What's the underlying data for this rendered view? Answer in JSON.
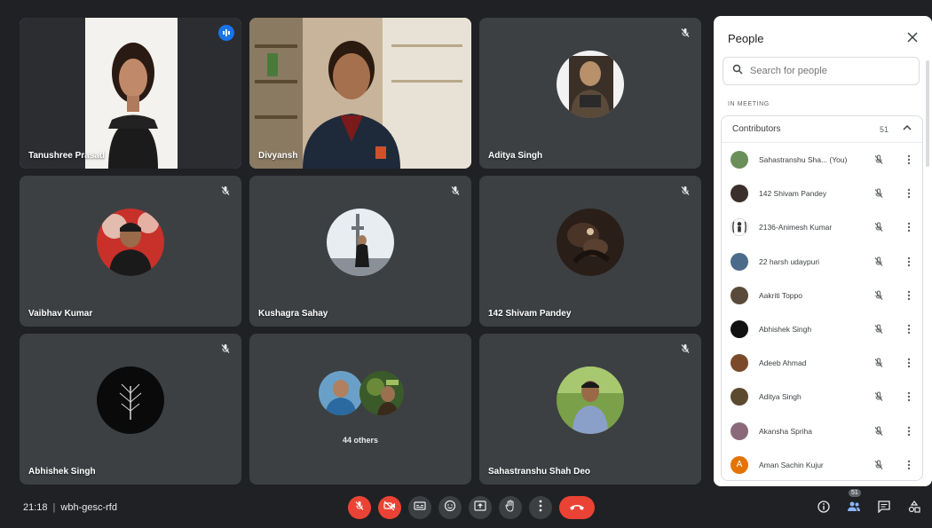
{
  "tiles": [
    {
      "name": "Tanushree Prasad",
      "kind": "video",
      "speaking": true
    },
    {
      "name": "Divyansh",
      "kind": "video"
    },
    {
      "name": "Aditya Singh",
      "kind": "avatar",
      "muted": true
    },
    {
      "name": "Vaibhav Kumar",
      "kind": "avatar",
      "muted": true
    },
    {
      "name": "Kushagra Sahay",
      "kind": "avatar",
      "muted": true
    },
    {
      "name": "142 Shivam Pandey",
      "kind": "avatar",
      "muted": true
    },
    {
      "name": "Abhishek Singh",
      "kind": "avatar",
      "muted": true
    },
    {
      "name": "",
      "kind": "others",
      "others_label": "44 others"
    },
    {
      "name": "Sahastranshu Shah Deo",
      "kind": "avatar",
      "muted": true
    }
  ],
  "panel": {
    "title": "People",
    "search_placeholder": "Search for people",
    "in_meeting_label": "IN MEETING",
    "contributors_label": "Contributors",
    "contributors_count": "51",
    "people": [
      {
        "name": "Sahastranshu Sha...  (You)",
        "color": "#6b8f5a"
      },
      {
        "name": "142 Shivam Pandey",
        "color": "#3a2f2a"
      },
      {
        "name": "2136-Animesh Kumar",
        "color": "#ffffff"
      },
      {
        "name": "22 harsh udaypuri",
        "color": "#4a6b8a"
      },
      {
        "name": "Aakriti Toppo",
        "color": "#5a4a3a"
      },
      {
        "name": "Abhishek Singh",
        "color": "#111111"
      },
      {
        "name": "Adeeb Ahmad",
        "color": "#7a4a2a"
      },
      {
        "name": "Aditya Singh",
        "color": "#5c4a2e"
      },
      {
        "name": "Akansha Spriha",
        "color": "#8a6a7a"
      },
      {
        "name": "Aman Sachin Kujur",
        "color": "#e37400",
        "initial": "A"
      }
    ]
  },
  "bottom": {
    "time": "21:18",
    "meeting_code": "wbh-gesc-rfd",
    "people_badge": "51"
  },
  "icons": {
    "mic_off": "mic-off-icon",
    "cam_off": "camera-off-icon",
    "cc": "captions-icon",
    "emoji": "emoji-icon",
    "present": "present-icon",
    "hand": "raise-hand-icon",
    "more": "more-vert-icon",
    "end": "end-call-icon",
    "info": "info-icon",
    "people": "people-icon",
    "chat": "chat-icon",
    "activities": "activities-icon"
  }
}
